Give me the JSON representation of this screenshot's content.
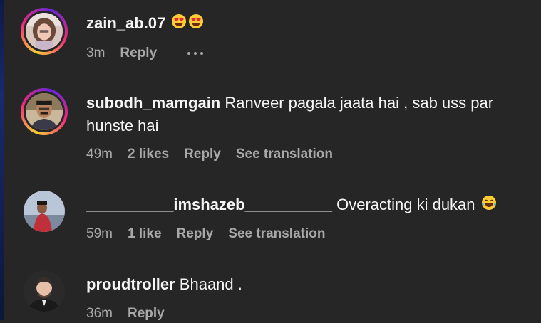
{
  "comments": [
    {
      "username": "zain_ab.07",
      "text": "",
      "emoji_after": [
        "heart-eyes-emoji",
        "heart-eyes-emoji"
      ],
      "time": "3m",
      "likes": "",
      "reply_label": "Reply",
      "translation_label": "",
      "has_more_menu": true,
      "story_ring": true
    },
    {
      "username": "subodh_mamgain",
      "text": "Ranveer pagala jaata hai , sab uss par hunste hai",
      "time": "49m",
      "likes": "2 likes",
      "reply_label": "Reply",
      "translation_label": "See translation",
      "story_ring": true
    },
    {
      "username": "__________imshazeb__________",
      "text": "Overacting ki dukan",
      "emoji_after": [
        "tears-of-joy-emoji"
      ],
      "time": "59m",
      "likes": "1 like",
      "reply_label": "Reply",
      "translation_label": "See translation",
      "story_ring": false
    },
    {
      "username": "proudtroller",
      "text": "Bhaand .",
      "time": "36m",
      "likes": "",
      "reply_label": "Reply",
      "translation_label": "",
      "story_ring": false
    }
  ],
  "colors": {
    "background": "#262626",
    "primary_text": "#f5f5f5",
    "secondary_text": "#a8a8a8",
    "story_ring_gradient": [
      "#f9ce34",
      "#ee2a7b",
      "#6228d7"
    ]
  }
}
